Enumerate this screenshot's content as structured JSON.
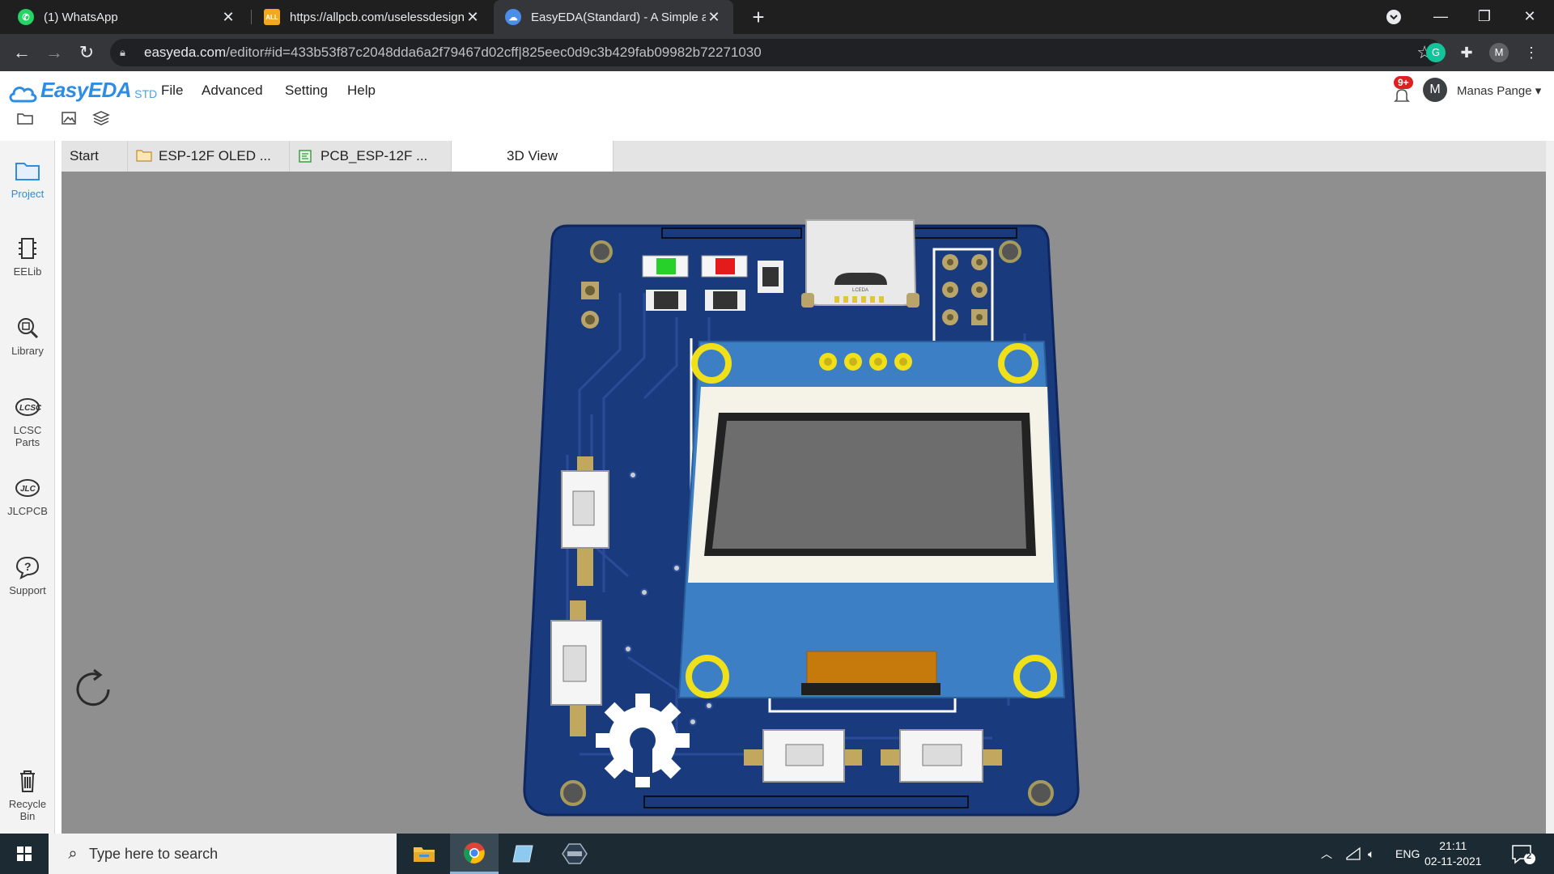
{
  "browser": {
    "tabs": [
      {
        "title": "(1) WhatsApp",
        "favicon": "whatsapp-icon"
      },
      {
        "title": "https://allpcb.com/uselessdesign",
        "favicon": "allpcb-icon"
      },
      {
        "title": "EasyEDA(Standard) - A Simple an",
        "favicon": "easyeda-icon"
      }
    ],
    "url_host": "easyeda.com",
    "url_path": "/editor#id=433b53f87c2048dda6a2f79467d02cff|825eec0d9c3b429fab09982b72271030",
    "profile_initial": "M"
  },
  "app": {
    "brand": "EasyEDA",
    "edition": "STD",
    "menu": [
      "File",
      "Advanced",
      "Setting",
      "Help"
    ],
    "notification_badge": "9+",
    "user_initial": "M",
    "user_name": "Manas Pange ▾"
  },
  "sidebar": [
    {
      "label": "Project",
      "icon": "folder-icon"
    },
    {
      "label": "EELib",
      "icon": "chip-icon"
    },
    {
      "label": "Library",
      "icon": "library-search-icon"
    },
    {
      "label": "LCSC Parts",
      "icon": "lcsc-icon"
    },
    {
      "label": "JLCPCB",
      "icon": "jlcpcb-icon"
    },
    {
      "label": "Support",
      "icon": "help-icon"
    },
    {
      "label": "Recycle Bin",
      "icon": "trash-icon"
    }
  ],
  "doc_tabs": [
    {
      "label": "Start"
    },
    {
      "label": "ESP-12F OLED ...",
      "icon": "folder-icon"
    },
    {
      "label": "PCB_ESP-12F ...",
      "icon": "pcb-icon"
    },
    {
      "label": "3D View"
    }
  ],
  "board": {
    "connector_marking": "LCEDA",
    "colors": {
      "pcb": "#1a3a7e",
      "oled_blue": "#3d7fc4",
      "led_green": "#28d02a",
      "led_red": "#e51a1a"
    }
  },
  "taskbar": {
    "search_placeholder": "Type here to search",
    "language": "ENG",
    "time": "21:11",
    "date": "02-11-2021",
    "notification_count": "2"
  }
}
